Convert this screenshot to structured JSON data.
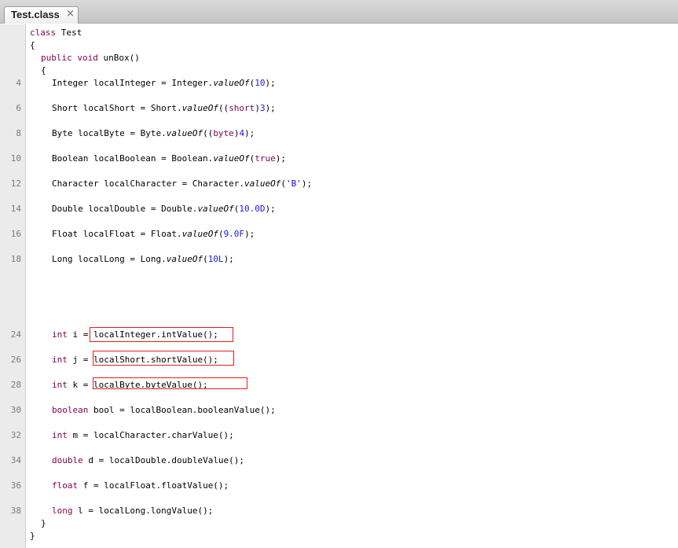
{
  "tab": {
    "title": "Test.class",
    "close_glyph": "×"
  },
  "gutter": {
    "line_numbers": [
      "4",
      "6",
      "8",
      "10",
      "12",
      "14",
      "16",
      "18",
      "24",
      "26",
      "28",
      "30",
      "32",
      "34",
      "36",
      "38"
    ]
  },
  "code": {
    "class_decl": {
      "kw": "class",
      "name": " Test"
    },
    "open_brace": "{",
    "method_decl": {
      "kw1": "public",
      "kw2": " void",
      "name": " unBox()"
    },
    "method_open": "{",
    "integer": {
      "pre": "Integer localInteger = Integer.",
      "method": "valueOf",
      "paren": "(",
      "value": "10",
      "end": ");"
    },
    "short": {
      "pre": "Short localShort = Short.",
      "method": "valueOf",
      "paren": "((",
      "cast": "short",
      "mid": ")",
      "value": "3",
      "end": ");"
    },
    "byte": {
      "pre": "Byte localByte = Byte.",
      "method": "valueOf",
      "paren": "((",
      "cast": "byte",
      "mid": ")",
      "value": "4",
      "end": ");"
    },
    "boolean": {
      "pre": "Boolean localBoolean = Boolean.",
      "method": "valueOf",
      "paren": "(",
      "value": "true",
      "end": ");"
    },
    "character": {
      "pre": "Character localCharacter = Character.",
      "method": "valueOf",
      "paren": "(",
      "value": "'B'",
      "end": ");"
    },
    "double": {
      "pre": "Double localDouble = Double.",
      "method": "valueOf",
      "paren": "(",
      "value": "10.0D",
      "end": ");"
    },
    "float": {
      "pre": "Float localFloat = Float.",
      "method": "valueOf",
      "paren": "(",
      "value": "9.0F",
      "end": ");"
    },
    "long": {
      "pre": "Long localLong = Long.",
      "method": "valueOf",
      "paren": "(",
      "value": "10L",
      "end": ");"
    },
    "int_i": {
      "kw": "int",
      "rest": " i = localInteger.intValue();"
    },
    "int_j": {
      "kw": "int",
      "rest": " j = localShort.shortValue();"
    },
    "int_k": {
      "kw": "int",
      "rest": " k = localByte.byteValue();"
    },
    "bool": {
      "kw": "boolean",
      "rest": " bool = localBoolean.booleanValue();"
    },
    "int_m": {
      "kw": "int",
      "rest": " m = localCharacter.charValue();"
    },
    "double_d": {
      "kw": "double",
      "rest": " d = localDouble.doubleValue();"
    },
    "float_f": {
      "kw": "float",
      "rest": " f = localFloat.floatValue();"
    },
    "long_l": {
      "kw": "long",
      "rest": " l = localLong.longValue();"
    },
    "method_close": "}",
    "class_close": "}"
  },
  "colors": {
    "keyword": "#7f0055",
    "number": "#1a1ae6",
    "highlight_box": "#e0211a"
  }
}
